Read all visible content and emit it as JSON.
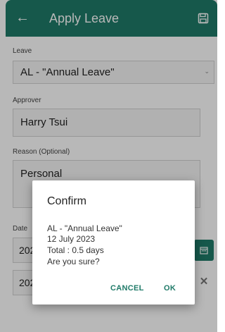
{
  "header": {
    "title": "Apply Leave",
    "back_icon": "arrow-left-icon",
    "save_icon": "floppy-disk-icon",
    "color": "#1f7a68"
  },
  "form": {
    "leave_label": "Leave",
    "leave_value": "AL - \"Annual Leave\"",
    "approver_label": "Approver",
    "approver_value": "Harry Tsui",
    "reason_label": "Reason (Optional)",
    "reason_value": "Personal",
    "date_label": "Date",
    "date_start_value": "202",
    "date_end_value": "202"
  },
  "dialog": {
    "title": "Confirm",
    "line1": "AL - \"Annual Leave\"",
    "line2": "12 July 2023",
    "line3": "Total : 0.5 days",
    "line4": "Are you sure?",
    "cancel_label": "CANCEL",
    "ok_label": "OK"
  }
}
